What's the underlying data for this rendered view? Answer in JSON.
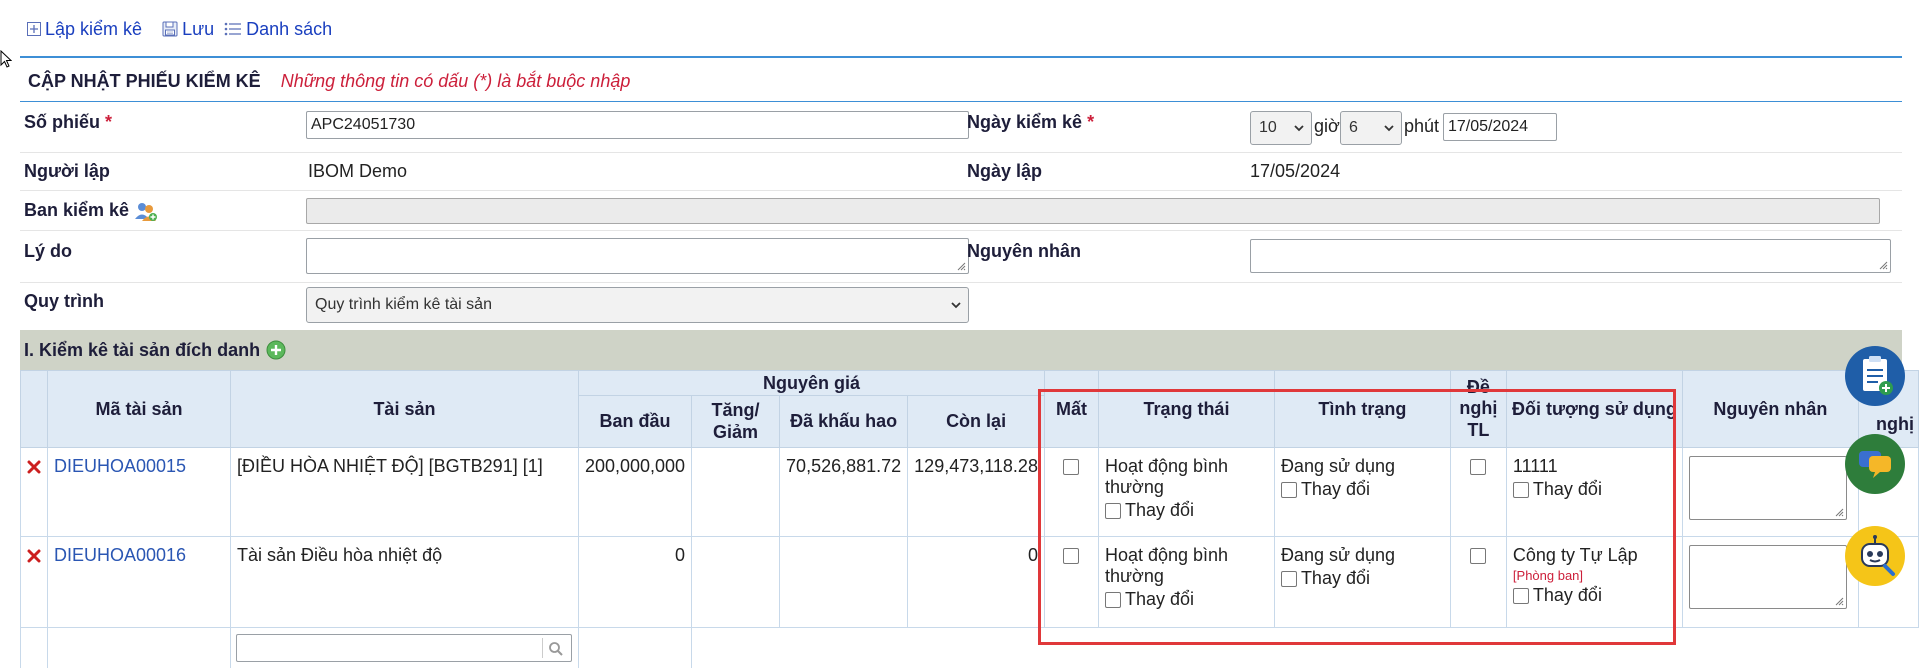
{
  "toolbar": {
    "create_label": "Lập kiểm kê",
    "save_label": "Lưu",
    "list_label": "Danh sách"
  },
  "header": {
    "title": "CẬP NHẬT PHIẾU KIỂM KÊ",
    "required_note": "Những thông tin có dấu (*) là bắt buộc nhập"
  },
  "form": {
    "so_phieu_label": "Số phiếu",
    "so_phieu_value": "APC24051730",
    "ngay_kiem_ke_label": "Ngày kiểm kê",
    "hour_value": "10",
    "hour_unit": "giờ",
    "minute_value": "6",
    "minute_unit": "phút",
    "ngay_kiem_ke_value": "17/05/2024",
    "nguoi_lap_label": "Người lập",
    "nguoi_lap_value": "IBOM Demo",
    "ngay_lap_label": "Ngày lập",
    "ngay_lap_value": "17/05/2024",
    "ban_kiem_ke_label": "Ban kiểm kê",
    "ly_do_label": "Lý do",
    "nguyen_nhan_label": "Nguyên nhân",
    "quy_trinh_label": "Quy trình",
    "quy_trinh_value": "Quy trình kiểm kê tài sản",
    "required_mark": "*"
  },
  "section": {
    "title": "I. Kiểm kê tài sản đích danh"
  },
  "table": {
    "headers": {
      "ma_tai_san": "Mã tài sản",
      "tai_san": "Tài sản",
      "nguyen_gia": "Nguyên giá",
      "ban_dau": "Ban đầu",
      "tang_giam": "Tăng/ Giảm",
      "da_khau_hao": "Đã khấu hao",
      "con_lai": "Còn lại",
      "mat": "Mất",
      "trang_thai": "Trạng thái",
      "tinh_trang": "Tình trạng",
      "de_nghi_tl": "Đề nghị TL",
      "doi_tuong": "Đối tượng sử dụng",
      "nguyen_nhan": "Nguyên nhân",
      "de_nghi": "nghị"
    },
    "change_label": "Thay đổi",
    "rows": [
      {
        "code": "DIEUHOA00015",
        "name": "[ĐIỀU HÒA NHIỆT ĐỘ] [BGTB291] [1]",
        "ban_dau": "200,000,000",
        "tang_giam": "",
        "da_khau_hao": "70,526,881.72",
        "con_lai": "129,473,118.28",
        "trang_thai": "Hoạt động bình thường",
        "tinh_trang": "Đang sử dụng",
        "doi_tuong": "11111",
        "doi_tuong_sub": ""
      },
      {
        "code": "DIEUHOA00016",
        "name": "Tài sản Điều hòa nhiệt độ",
        "ban_dau": "0",
        "tang_giam": "",
        "da_khau_hao": "",
        "con_lai": "0",
        "trang_thai": "Hoạt động bình thường",
        "tinh_trang": "Đang sử dụng",
        "doi_tuong": "Công ty Tự Lập",
        "doi_tuong_sub": "[Phòng ban]"
      }
    ]
  },
  "colors": {
    "link": "#2a56b3",
    "required": "#cc1f3a",
    "highlight": "#e0383a",
    "section_bg": "#cfd3c7",
    "header_bg": "#dfeaf5"
  },
  "icons": [
    "add-square-icon",
    "save-disk-icon",
    "list-icon",
    "group-users-icon",
    "add-circle-icon",
    "delete-x-icon",
    "search-icon",
    "clipboard-add-icon",
    "chat-icon",
    "robot-support-icon"
  ]
}
